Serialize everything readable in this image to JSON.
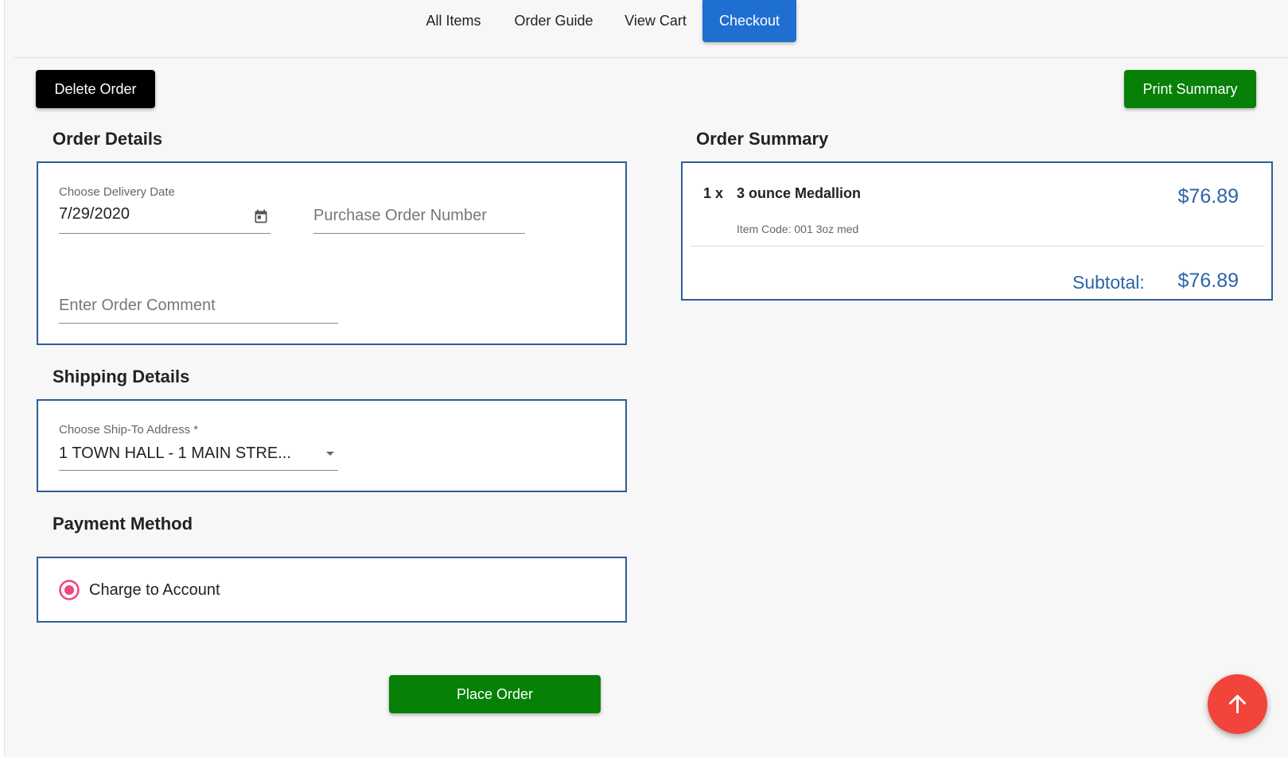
{
  "nav": {
    "tabs": [
      {
        "label": "All Items"
      },
      {
        "label": "Order Guide"
      },
      {
        "label": "View Cart"
      },
      {
        "label": "Checkout"
      }
    ],
    "active_tab": "Checkout"
  },
  "toolbar": {
    "delete_label": "Delete Order",
    "print_label": "Print Summary"
  },
  "order_details": {
    "title": "Order Details",
    "delivery_date_label": "Choose Delivery Date",
    "delivery_date_value": "7/29/2020",
    "po_placeholder": "Purchase Order Number",
    "comment_placeholder": "Enter Order Comment"
  },
  "shipping": {
    "title": "Shipping Details",
    "address_label": "Choose Ship-To Address *",
    "address_value": "1 TOWN HALL - 1 MAIN STRE..."
  },
  "payment": {
    "title": "Payment Method",
    "option_label": "Charge to Account",
    "selected": true
  },
  "summary": {
    "title": "Order Summary",
    "items": [
      {
        "qty": "1 x",
        "name": "3 ounce Medallion",
        "code": "Item Code: 001 3oz med",
        "price": "$76.89"
      }
    ],
    "subtotal_label": "Subtotal:",
    "subtotal_value": "$76.89"
  },
  "place_order_label": "Place Order",
  "colors": {
    "accent": "#1e6fcf",
    "green": "#068006",
    "card_border": "#2f5d98",
    "price_blue": "#2f63a6",
    "radio_pink": "#f0457a",
    "fab_red": "#f2443a"
  },
  "icons": {
    "calendar": "calendar-icon",
    "dropdown": "caret-down-icon",
    "scroll_top": "arrow-up-icon"
  }
}
